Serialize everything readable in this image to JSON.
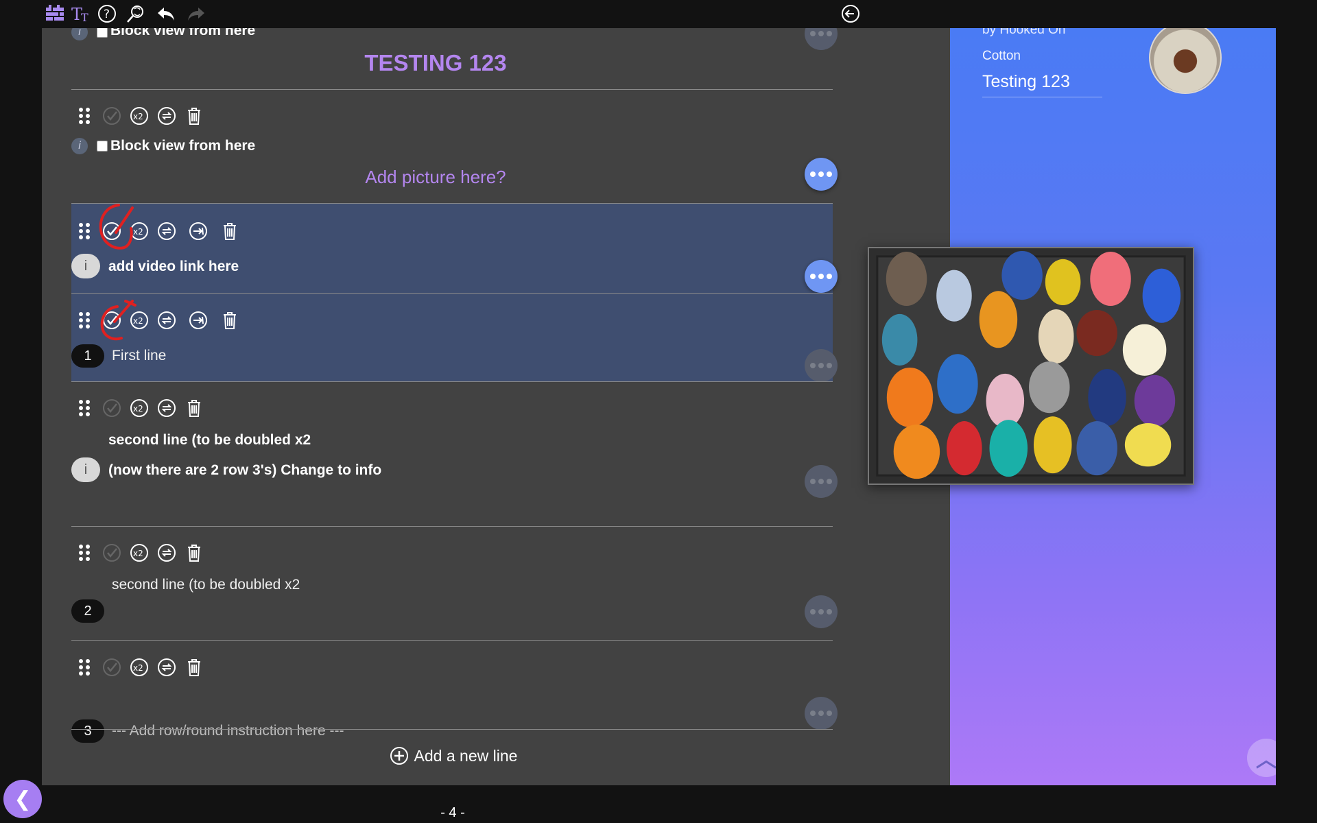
{
  "toolbar": {
    "icons": [
      "pattern-icon",
      "text-size-icon",
      "help-icon",
      "search-replace-icon",
      "undo-icon",
      "redo-icon",
      "exit-icon"
    ]
  },
  "sidebar": {
    "by_line": "by Hooked On",
    "yarn": "Cotton",
    "pattern_title": "Testing 123"
  },
  "content": {
    "block_view_label": "Block view from here",
    "heading": "TESTING 123",
    "add_picture": "Add picture here?",
    "rows": [
      {
        "info_text": "add video link here"
      },
      {
        "number": "1",
        "text": "First line"
      },
      {
        "text_line1": "second line (to be doubled x2",
        "text_line2": "(now there are 2 row 3's) Change to info"
      },
      {
        "number": "2",
        "text": "second line (to be doubled x2"
      },
      {
        "number": "3",
        "placeholder": "--- Add row/round instruction here ---"
      }
    ],
    "add_line_label": "Add a new line",
    "info_letter": "i"
  },
  "footer": {
    "page": "- 4 -",
    "back_glyph": "❮",
    "top_glyph": "︿"
  },
  "colors": {
    "accent": "#b486ef",
    "highlight_row": "#3f4e70",
    "panel": "#424242",
    "sidebar_top": "#4a7bf4",
    "sidebar_bottom": "#ad79f7",
    "annotation_red": "#e02020"
  }
}
